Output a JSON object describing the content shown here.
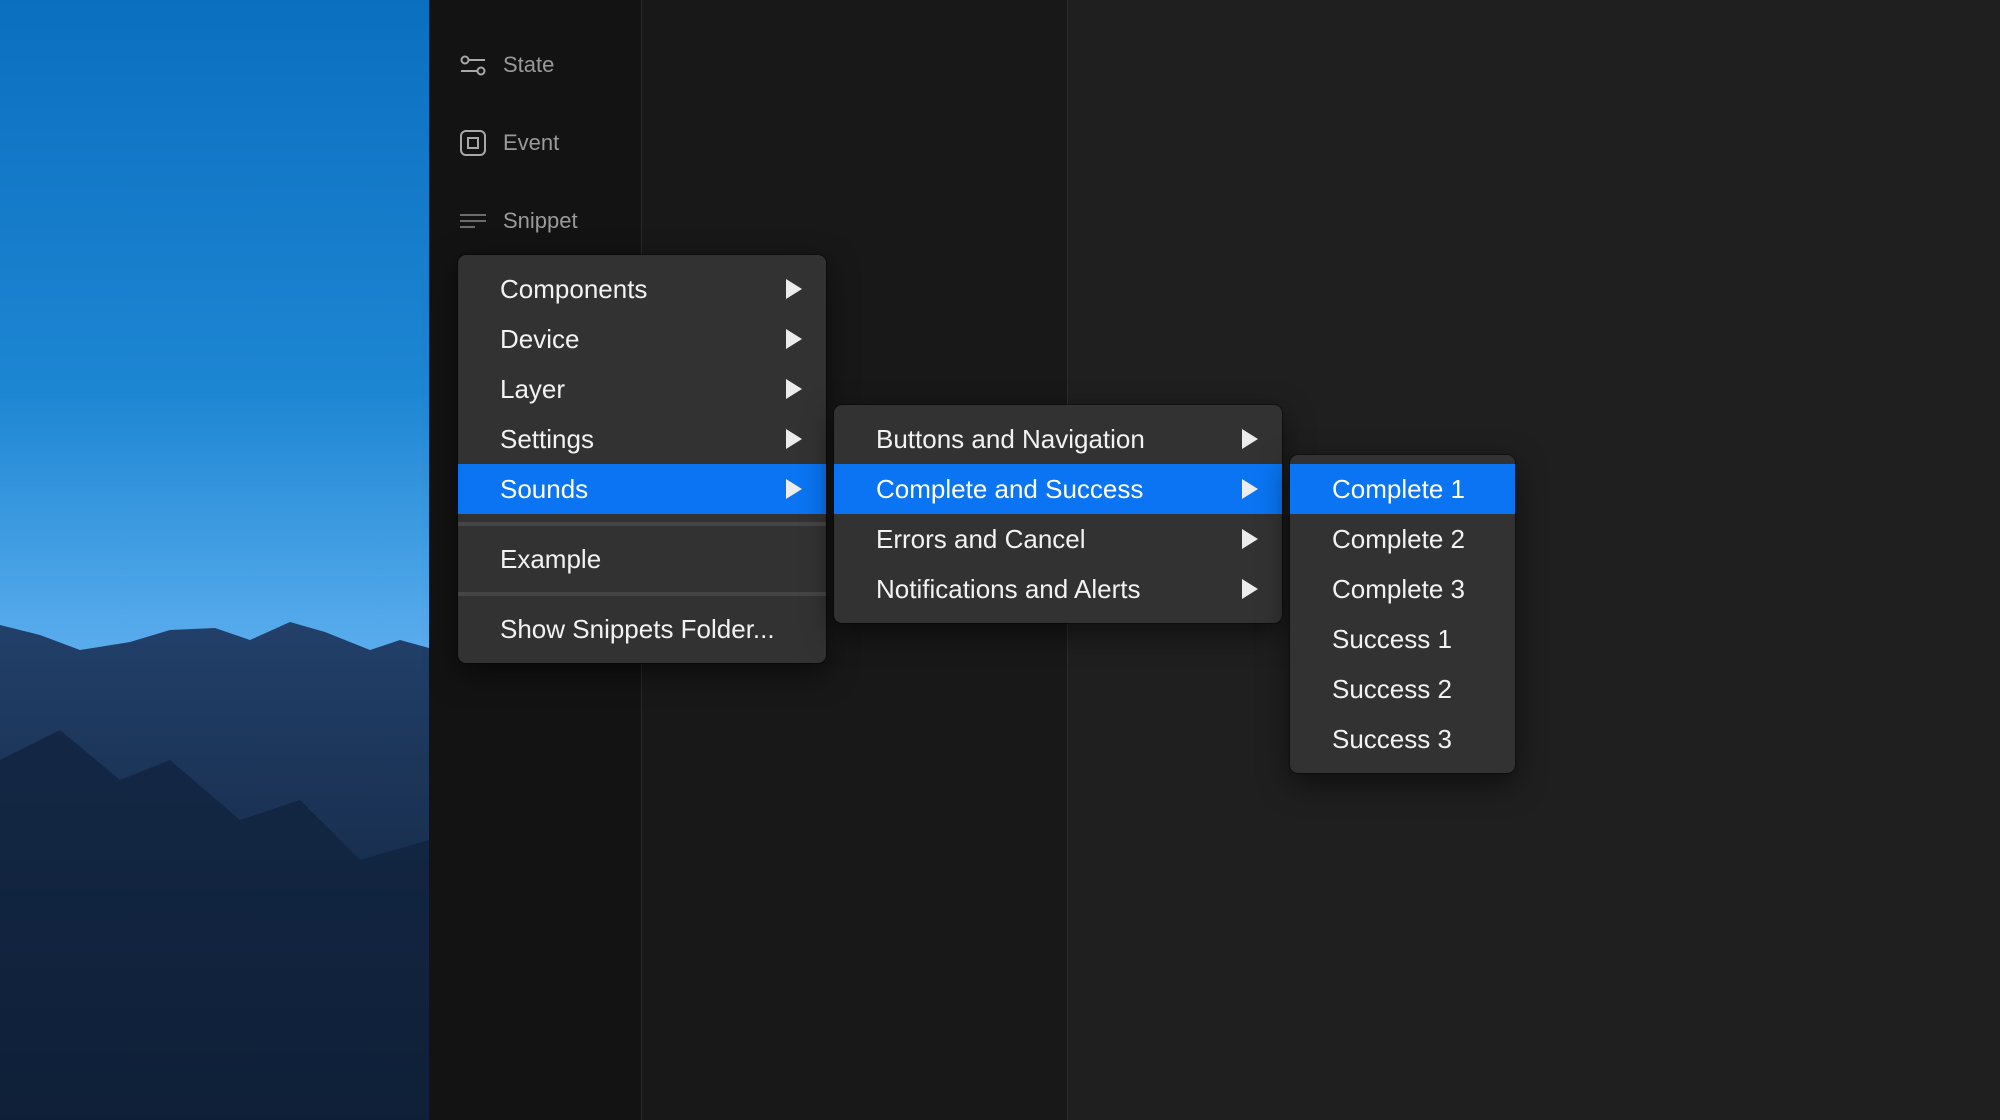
{
  "sidebar": {
    "items": [
      {
        "label": "State",
        "icon": "state-toggle-icon"
      },
      {
        "label": "Event",
        "icon": "event-square-icon"
      },
      {
        "label": "Snippet",
        "icon": "snippet-lines-icon"
      }
    ]
  },
  "menus": {
    "main": {
      "items": [
        "Components",
        "Device",
        "Layer",
        "Settings",
        "Sounds"
      ],
      "active": "Sounds",
      "example": "Example",
      "folder": "Show Snippets Folder..."
    },
    "sounds": {
      "items": [
        "Buttons and Navigation",
        "Complete and Success",
        "Errors and Cancel",
        "Notifications and Alerts"
      ],
      "active": "Complete and Success"
    },
    "complete": {
      "items": [
        "Complete 1",
        "Complete 2",
        "Complete 3",
        "Success 1",
        "Success 2",
        "Success 3"
      ],
      "active": "Complete 1"
    }
  },
  "colors": {
    "accent": "#0a74f2",
    "menu_bg": "#323232",
    "sidebar_bg": "#131313"
  }
}
